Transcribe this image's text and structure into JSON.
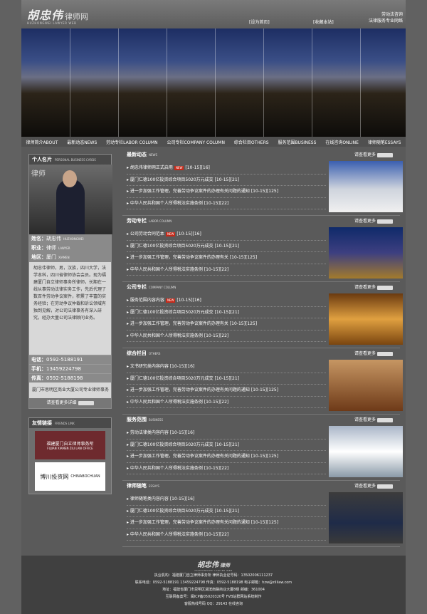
{
  "header": {
    "logo_cn": "胡忠伟",
    "logo_sub": "律师网",
    "logo_en": "HUZHONGWEI LAWYER WEB",
    "links": [
      "[设为首页]",
      "[收藏本站]"
    ],
    "email": [
      "劳动法咨询",
      "法律服务专业网络"
    ]
  },
  "nav": [
    "律师简介ABOUT",
    "最新动态NEWS",
    "劳动专栏LABOR COLUMN",
    "公司专栏COMPANY COLUMN",
    "综合栏目OTHERS",
    "服务范围BUSINESS",
    "在线咨询ONLINE",
    "律师随笔ESSAYS"
  ],
  "profile": {
    "title": "个人名片",
    "title_en": "PERSONAL BUSINESS CARDS",
    "name_label": "姓名：",
    "name": "胡忠伟",
    "name_en": "HUZHONGWEI",
    "job_label": "职业：",
    "job": "律师",
    "job_en": "LAWYER",
    "area_label": "地区：",
    "area": "厦门",
    "area_en": "XIAMEN",
    "bio": "胡忠伟律师，男，汉族，四川大学，法学本科，四川省律师协会会员。现为福建厦门自立律师事务所律师，长期在一线从事劳动法律实务工作，先后代理了数百件劳动争议案件，积累了丰富的实务经验；在劳动争议仲裁和诉讼领域有独到见解，对公司法律事务有深入研究，经办大量公司法律顾问业务。",
    "tel_label": "电话：",
    "tel": "0592-5188191",
    "mobile_label": "手机：",
    "mobile": "13459224798",
    "fax_label": "传真：",
    "fax": "0592-5188198",
    "addr": "厦门市思明区商业大厦公司专业律师事务",
    "more": "请查看更多详细"
  },
  "friends": {
    "title": "友情链接",
    "title_en": "FRIENDS LINK",
    "links": [
      {
        "name": "福建厦门自立律师事务所",
        "en": "FUJIAN XIAMEN ZILI LAW OFFICE"
      },
      {
        "name": "博川投资网",
        "en": "CHINABOCHUAN"
      }
    ]
  },
  "sections": [
    {
      "title": "最新动态",
      "title_en": "NEWS",
      "more": "请查看更多",
      "items": [
        "胡忠伟律师网正式启用",
        "厦门仁德100亿投资综合项目5020万元成交 [10-15][21]",
        "进一步加强工作管理，完善劳动争议案件的办理有关问题的通知 [10-15][125]",
        "中华人民共和国个人所得税法实施条例 [10-15][22]"
      ]
    },
    {
      "title": "劳动专栏",
      "title_en": "LABOR COLUMN",
      "more": "请查看更多",
      "items": [
        "公司劳动合同范本",
        "厦门仁德100亿投资综合项目5020万元成交 [10-15][21]",
        "进一步加强工作管理，完善劳动争议案件的办理有关 [10-15][125]",
        "中华人民共和国个人所得税法实施条例 [10-15][22]"
      ]
    },
    {
      "title": "公司专栏",
      "title_en": "COMPANY COLUMN",
      "more": "请查看更多",
      "items": [
        "服务范围内容内容",
        "厦门仁德100亿投资综合项目5020万元成交 [10-15][21]",
        "进一步加强工作管理，完善劳动争议案件的办理有关 [10-15][125]",
        "中华人民共和国个人所得税法实施条例 [10-15][22]"
      ]
    },
    {
      "title": "综合栏目",
      "title_en": "OTHERS",
      "more": "请查看更多",
      "items": [
        "文书研究类内容内容 [10-15][16]",
        "厦门仁德100亿投资综合项目5020万元成交 [10-15][21]",
        "进一步加强工作管理，完善劳动争议案件的办理有关问题的通知 [10-15][125]",
        "中华人民共和国个人所得税法实施条例 [10-15][22]"
      ]
    },
    {
      "title": "服务范围",
      "title_en": "BUSINESS",
      "more": "请查看更多",
      "items": [
        "劳动法律类内容内容 [10-15][16]",
        "厦门仁德100亿投资综合项目5020万元成交 [10-15][21]",
        "进一步加强工作管理，完善劳动争议案件的办理有关问题的通知 [10-15][125]",
        "中华人民共和国个人所得税法实施条例 [10-15][22]"
      ]
    },
    {
      "title": "律师随笔",
      "title_en": "ESSAYS",
      "more": "请查看更多",
      "items": [
        "律师随笔类内容内容 [10-15][16]",
        "厦门仁德100亿投资综合项目5020万元成交 [10-15][21]",
        "进一步加强工作管理，完善劳动争议案件的办理有关问题的通知 [10-15][125]",
        "中华人民共和国个人所得税法实施条例 [10-15][22]"
      ]
    }
  ],
  "footer": {
    "logo_cn": "胡忠伟",
    "logo_sub": "律师",
    "logo_en": "HUZHONGWEI LAWYER WEB",
    "lines": [
      "执业机构：福建厦门自立律师事务所 律师执业证号码：13502006111237",
      "联系电话：0592-5188191 13459224798 传真：0592-5188198 电子邮箱：hzw@zililaw.com",
      "地址：福建省厦门市思明区湖滨南路商业大厦8楼 邮编：361004",
      "互联网备案号：闽ICP备05020320号 FVB站群网站系统制作",
      "客服热线号码 QQ：29143 在线咨询"
    ]
  }
}
